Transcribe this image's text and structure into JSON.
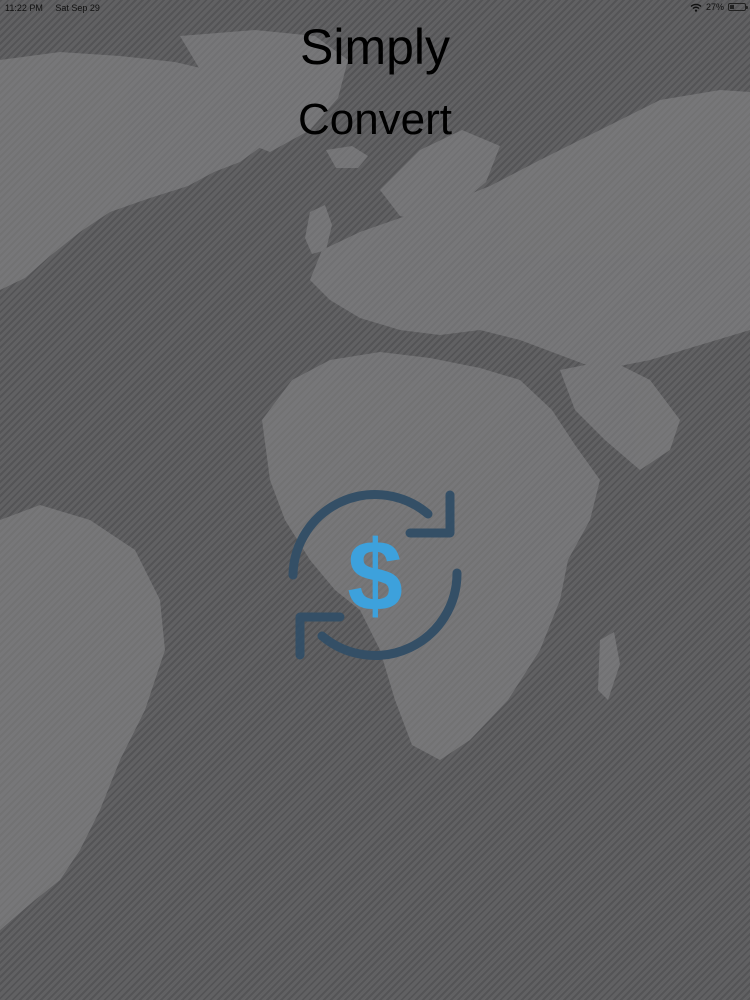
{
  "status_bar": {
    "time": "11:22 PM",
    "date": "Sat Sep 29",
    "battery_percent_label": "27%",
    "battery_level": 0.27,
    "wifi_icon": "wifi-icon",
    "battery_icon": "battery-icon"
  },
  "app": {
    "title_line1": "Simply",
    "title_line2": "Convert"
  },
  "logo": {
    "icon": "currency-exchange-icon",
    "symbol": "$",
    "arrow_color": "#344f66",
    "symbol_color": "#3da1dc"
  },
  "colors": {
    "background": "#5b5b5d",
    "continents": "#8a8a8c"
  }
}
